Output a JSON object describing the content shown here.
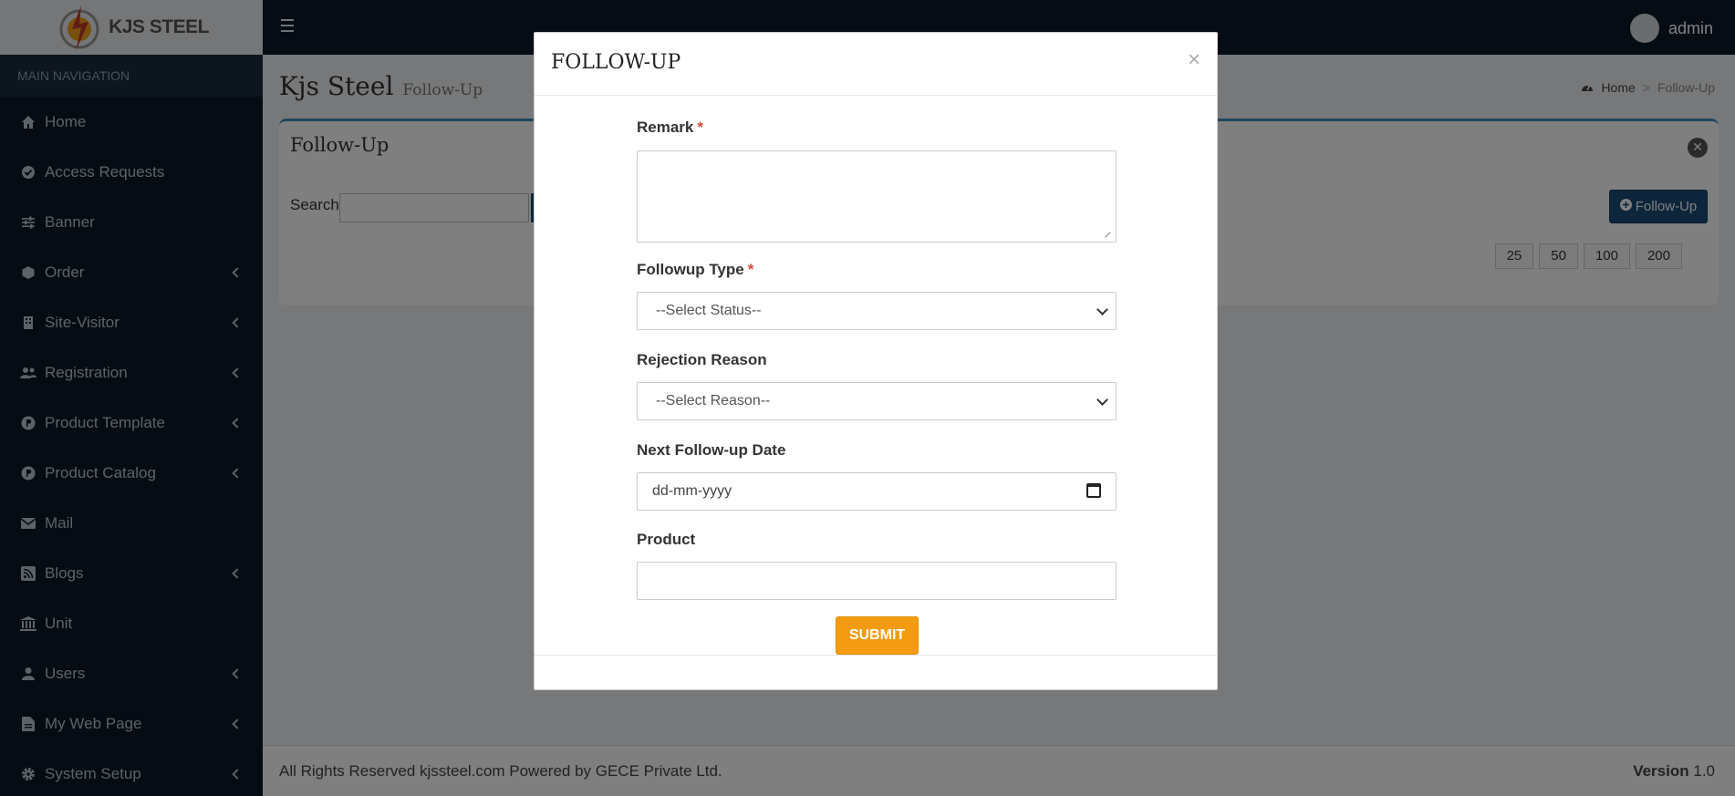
{
  "brand": {
    "logo_text": "KJS STEEL"
  },
  "sidebar": {
    "header": "MAIN NAVIGATION",
    "items": [
      {
        "label": "Home",
        "icon": "home-icon",
        "has_children": false
      },
      {
        "label": "Access Requests",
        "icon": "check-circle-icon",
        "has_children": false
      },
      {
        "label": "Banner",
        "icon": "sliders-icon",
        "has_children": false
      },
      {
        "label": "Order",
        "icon": "cube-icon",
        "has_children": true
      },
      {
        "label": "Site-Visitor",
        "icon": "building-icon",
        "has_children": true
      },
      {
        "label": "Registration",
        "icon": "users-icon",
        "has_children": true
      },
      {
        "label": "Product Template",
        "icon": "product-p-icon",
        "has_children": true
      },
      {
        "label": "Product Catalog",
        "icon": "product-p-icon",
        "has_children": true
      },
      {
        "label": "Mail",
        "icon": "envelope-icon",
        "has_children": false
      },
      {
        "label": "Blogs",
        "icon": "rss-icon",
        "has_children": true
      },
      {
        "label": "Unit",
        "icon": "bank-icon",
        "has_children": false
      },
      {
        "label": "Users",
        "icon": "user-icon",
        "has_children": true
      },
      {
        "label": "My Web Page",
        "icon": "file-icon",
        "has_children": true
      },
      {
        "label": "System Setup",
        "icon": "gear-icon",
        "has_children": true
      }
    ]
  },
  "header": {
    "user_name": "admin"
  },
  "page": {
    "title": "Kjs Steel",
    "subtitle": "Follow-Up",
    "breadcrumb": {
      "home": "Home",
      "current": "Follow-Up"
    }
  },
  "box": {
    "title": "Follow-Up",
    "search_label": "Search",
    "search_value": "",
    "add_button": "Follow-Up",
    "page_sizes": [
      "25",
      "50",
      "100",
      "200"
    ]
  },
  "footer": {
    "left": "All Rights Reserved kjssteel.com Powered by GECE Private Ltd.",
    "version_label": "Version",
    "version_value": "1.0"
  },
  "modal": {
    "title": "FOLLOW-UP",
    "close_glyph": "×",
    "fields": {
      "remark": {
        "label": "Remark",
        "required_mark": "*",
        "value": ""
      },
      "followup_type": {
        "label": "Followup Type",
        "required_mark": "*",
        "selected": "--Select Status--"
      },
      "rejection_reason": {
        "label": "Rejection Reason",
        "selected": "--Select Reason--"
      },
      "next_date": {
        "label": "Next Follow-up Date",
        "placeholder": "dd-mm-yyyy"
      },
      "product": {
        "label": "Product",
        "value": ""
      }
    },
    "submit_label": "SUBMIT"
  },
  "colors": {
    "accent": "#1b4c76",
    "submit": "#f39c12",
    "sidebar_bg": "#0b1929",
    "required": "#dd4b39"
  }
}
